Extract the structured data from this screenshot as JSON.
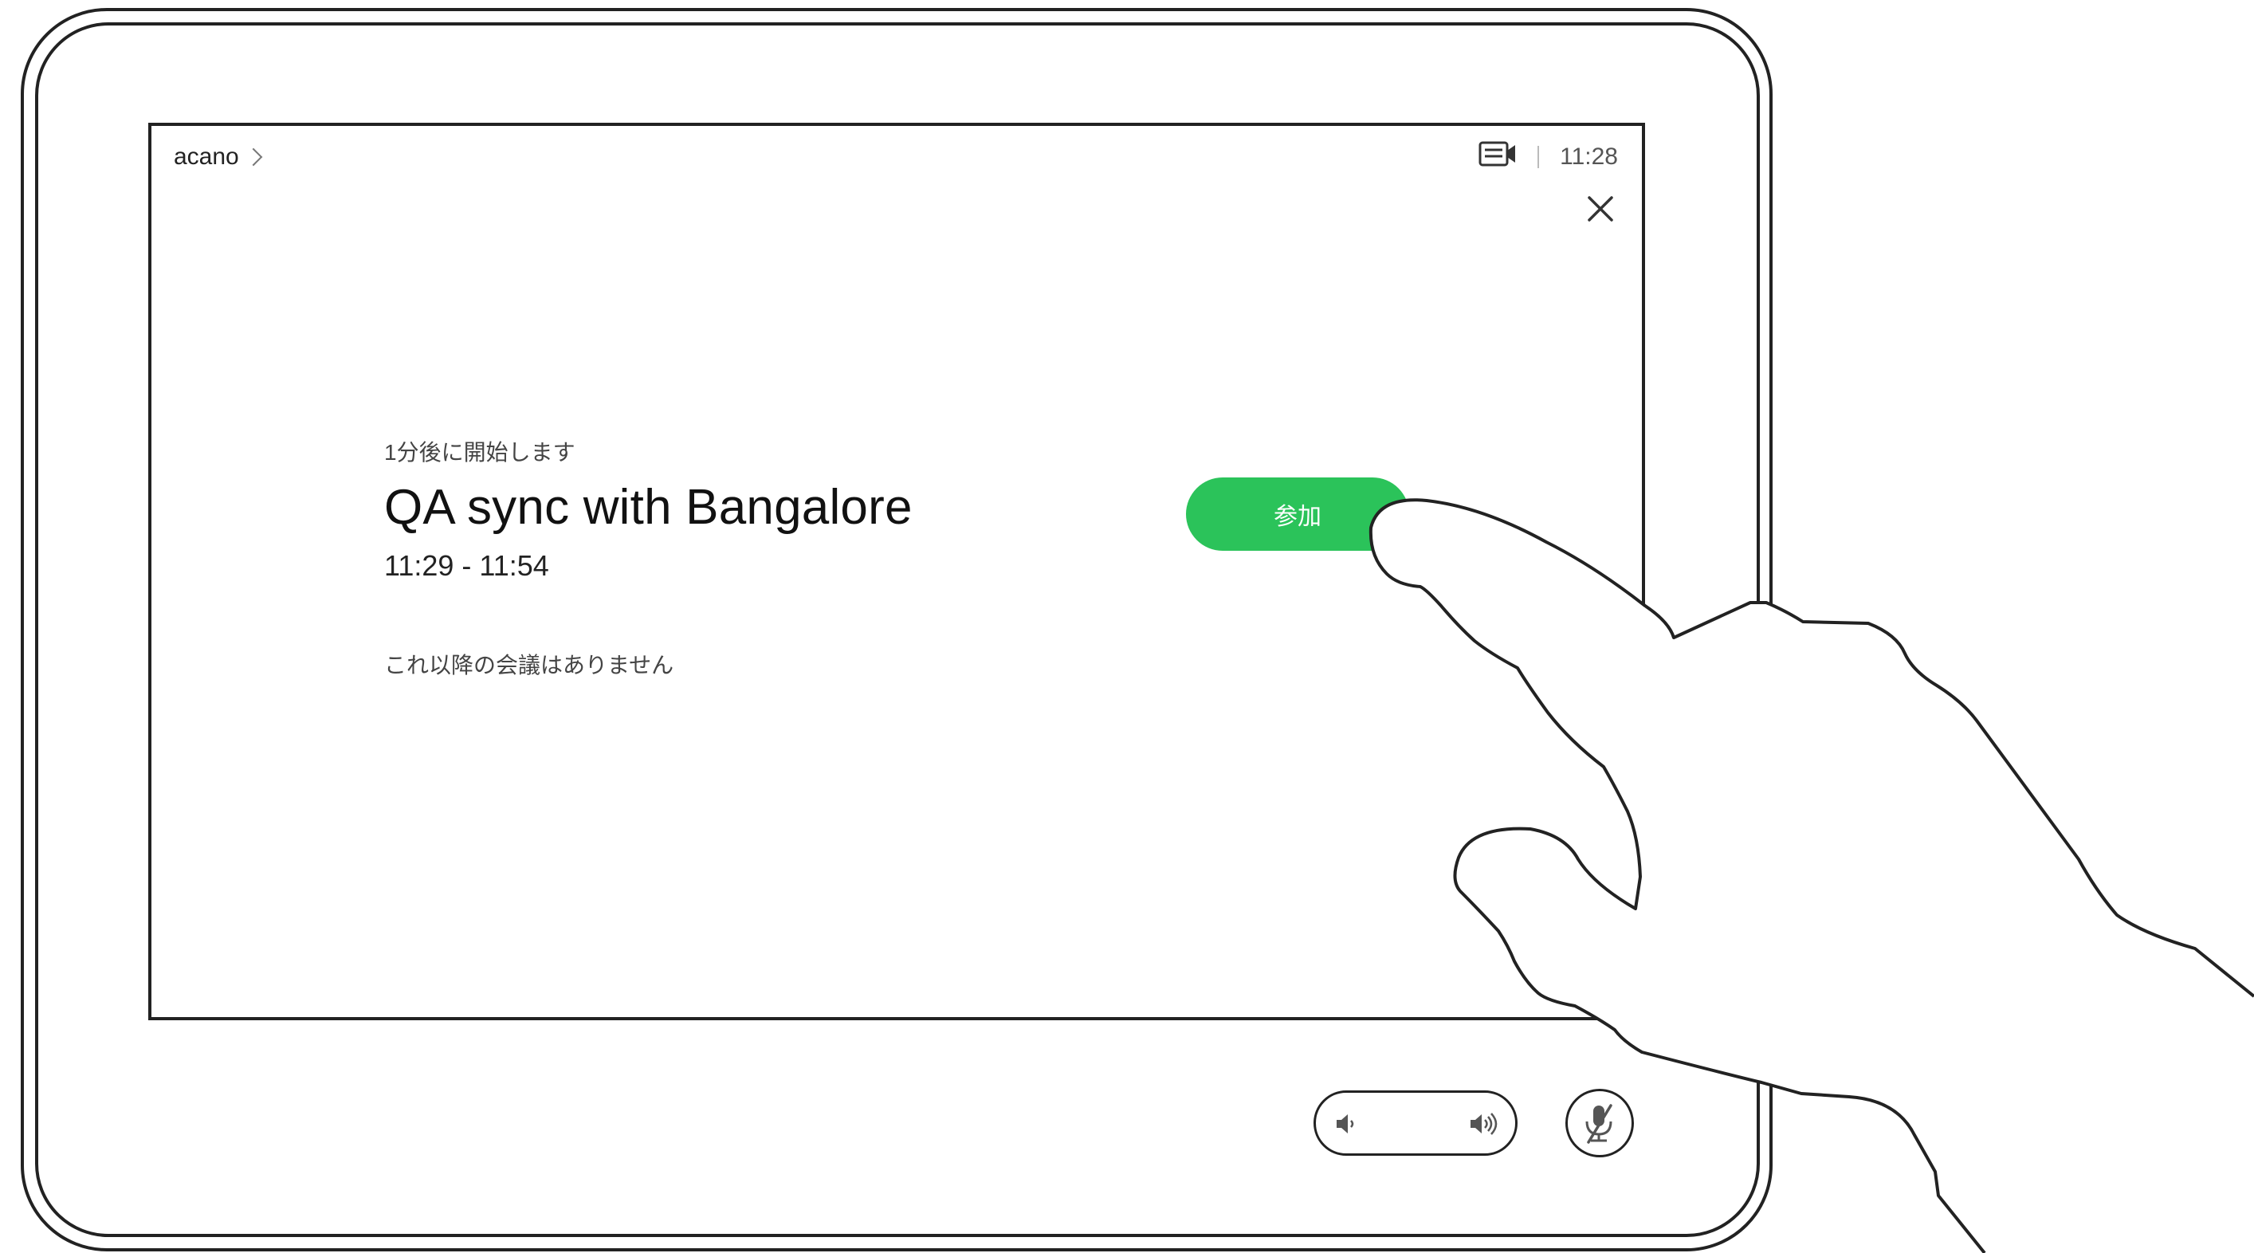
{
  "header": {
    "system_name": "acano",
    "time": "11:28"
  },
  "meeting": {
    "starts_in": "1分後に開始します",
    "title": "QA sync with Bangalore",
    "time_range": "11:29 - 11:54",
    "no_more_meetings": "これ以降の会議はありません"
  },
  "actions": {
    "join_label": "参加",
    "join_color": "#2bc35a"
  },
  "icons": {
    "camera": "video-camera-icon",
    "close": "close-icon",
    "volume_down": "volume-down-icon",
    "volume_up": "volume-up-icon",
    "mute": "microphone-mute-icon"
  }
}
